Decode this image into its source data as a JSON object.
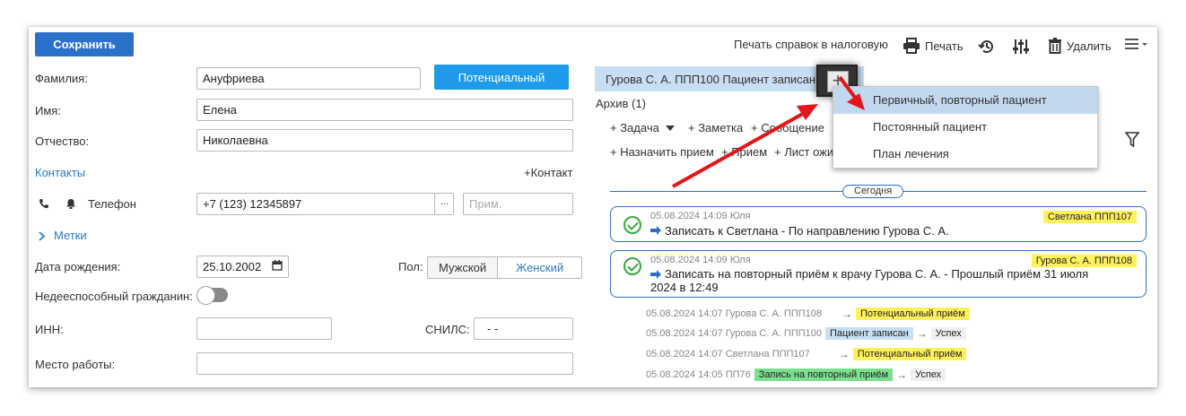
{
  "toolbar": {
    "save_label": "Сохранить",
    "print_tax": "Печать справок в налоговую",
    "print": "Печать",
    "delete": "Удалить"
  },
  "form": {
    "surname_label": "Фамилия:",
    "surname_value": "Ануфриева",
    "status_button": "Потенциальный",
    "name_label": "Имя:",
    "name_value": "Елена",
    "patronymic_label": "Отчество:",
    "patronymic_value": "Николаевна",
    "contacts_label": "Контакты",
    "add_contact": "+Контакт",
    "phone_label": "Телефон",
    "phone_value": "+7 (123) 12345897",
    "phone_btn": "...",
    "note_placeholder": "Прим.",
    "tags_label": "Метки",
    "birth_label": "Дата рождения:",
    "birth_value": "25.10.2002",
    "gender_label": "Пол:",
    "gender_male": "Мужской",
    "gender_female": "Женский",
    "incapable_label": "Недееспособный гражданин:",
    "inn_label": "ИНН:",
    "snils_label": "СНИЛС:",
    "snils_value": "-  -",
    "work_label": "Место работы:"
  },
  "right": {
    "header_text": "Гурова С. А. ППП100  Пациент записан",
    "archive": "Архив (1)",
    "actions_row1": [
      "+ Задача",
      "+ Заметка",
      "+ Сообщение"
    ],
    "actions_row2": [
      "+ Назначить прием",
      "+ Прием",
      "+ Лист ожи"
    ],
    "today": "Сегодня",
    "dropdown": [
      "Первичный, повторный пациент",
      "Постоянный пациент",
      "План лечения"
    ]
  },
  "feed": [
    {
      "meta": "05.08.2024 14:09 Юля",
      "tag": "Светлана ППП107",
      "text": "Записать к Светлана - По направлению Гурова С. А."
    },
    {
      "meta": "05.08.2024 14:09 Юля",
      "tag": "Гурова С. А. ППП108",
      "text": "Записать на повторный приём к врачу Гурова С. А. - Прошлый приём 31 июля 2024 в 12:49"
    }
  ],
  "history": [
    {
      "meta": "05.08.2024 14:07 Гурова С. А. ППП108",
      "tag": "Потенциальный приём",
      "tag_color": "yellow",
      "result": ""
    },
    {
      "meta": "05.08.2024 14:07 Гурова С. А. ППП100",
      "tag": "Пациент записан",
      "tag_color": "blue",
      "result": "Успех"
    },
    {
      "meta": "05.08.2024 14:07 Светлана ППП107",
      "tag": "Потенциальный приём",
      "tag_color": "yellow",
      "result": ""
    },
    {
      "meta": "05.08.2024 14:05 ПП76",
      "tag": "Запись на повторный приём",
      "tag_color": "green",
      "result": "Успех"
    }
  ],
  "colors": {
    "primary": "#2b70c9",
    "status_blue": "#1e9bea",
    "highlight_yellow": "#fff15c",
    "annotation_red": "#e4161b"
  }
}
